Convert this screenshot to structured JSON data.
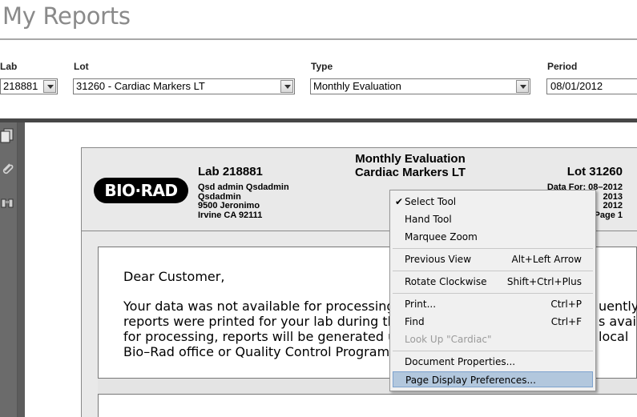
{
  "page": {
    "title": "My Reports"
  },
  "filters": {
    "lab": {
      "label": "Lab",
      "value": "218881"
    },
    "lot": {
      "label": "Lot",
      "value": "31260 - Cardiac Markers LT"
    },
    "type": {
      "label": "Type",
      "value": "Monthly Evaluation"
    },
    "period": {
      "label": "Period",
      "value": "08/01/2012"
    }
  },
  "report": {
    "logo_text": "BIO·RAD",
    "lab_name": "Lab 218881",
    "address": [
      "Qsd admin   Qsdadmin",
      "Qsdadmin",
      "9500 Jeronimo",
      "Irvine CA 92111"
    ],
    "title_line1": "Monthly Evaluation",
    "title_line2": "Cardiac Markers LT",
    "lot": "Lot 31260",
    "data_for": "Data For: 08–2012",
    "right_lines": [
      "2013",
      "2012",
      "Page 1"
    ]
  },
  "letter": {
    "greeting": "Dear Customer,",
    "lines": [
      "Your data was not available for processing",
      "reports were printed for your lab during this",
      "for processing, reports will be generated up",
      "Bio–Rad office or Quality Control Program c"
    ],
    "right_fragments": [
      "uently n",
      "s availa",
      "local"
    ]
  },
  "context_menu": {
    "items": [
      {
        "label": "Select Tool",
        "shortcut": "",
        "checked": "✔"
      },
      {
        "label": "Hand Tool",
        "shortcut": ""
      },
      {
        "label": "Marquee Zoom",
        "shortcut": ""
      },
      {
        "label": "Previous View",
        "shortcut": "Alt+Left Arrow"
      },
      {
        "label": "Rotate Clockwise",
        "shortcut": "Shift+Ctrl+Plus"
      },
      {
        "label": "Print...",
        "shortcut": "Ctrl+P"
      },
      {
        "label": "Find",
        "shortcut": "Ctrl+F"
      },
      {
        "label": "Look Up \"Cardiac\"",
        "shortcut": ""
      },
      {
        "label": "Document Properties...",
        "shortcut": ""
      },
      {
        "label": "Page Display Preferences...",
        "shortcut": ""
      }
    ]
  },
  "icons": [
    "pages-icon",
    "attachment-icon",
    "binoculars-icon"
  ]
}
